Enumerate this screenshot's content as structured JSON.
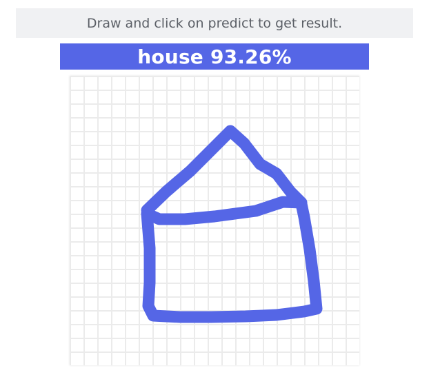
{
  "instruction": {
    "text": "Draw and click on predict to get result."
  },
  "prediction": {
    "label": "house",
    "confidence": "93.26%",
    "display": "house 93.26%"
  },
  "canvas": {
    "stroke_color": "#5566e6",
    "grid_color": "#ebebeb"
  },
  "colors": {
    "accent": "#5566e6",
    "instruction_bg": "#f0f1f3",
    "instruction_text": "#5b5f66"
  }
}
